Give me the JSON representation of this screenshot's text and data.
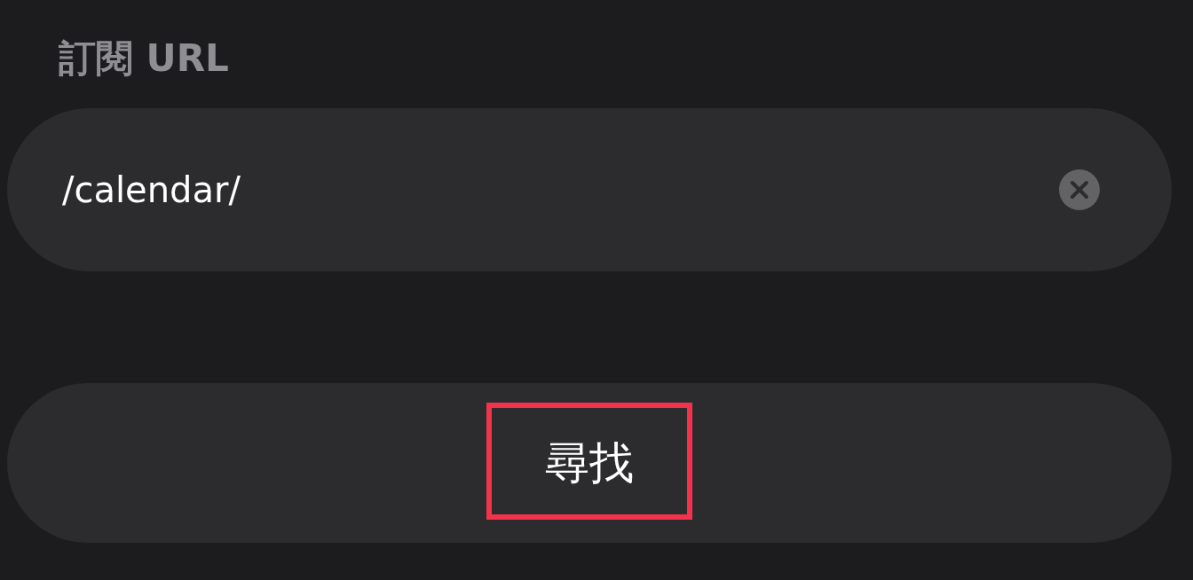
{
  "section_label": "訂閱 URL",
  "url_field": {
    "value": "/calendar/"
  },
  "find_button": {
    "label": "尋找",
    "highlighted": true
  }
}
